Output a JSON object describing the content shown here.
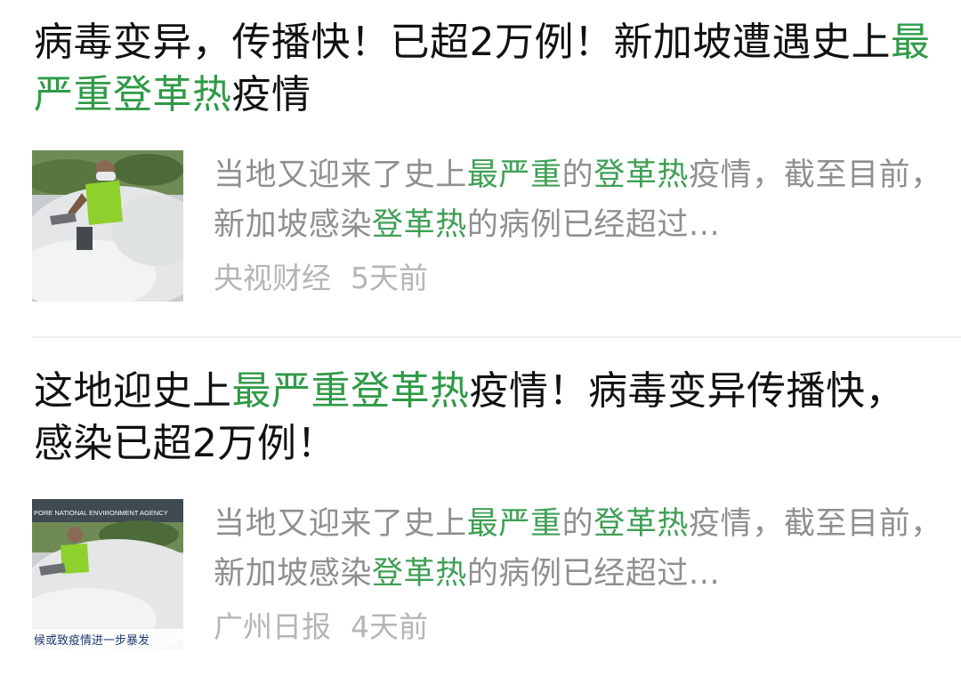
{
  "articles": [
    {
      "title": {
        "p1": "病毒变异，传播快！已超2万例！新加坡遭遇史上",
        "p2": "最严重登革热",
        "p3": "疫情"
      },
      "summary": {
        "s1": "当地又迎来了史上",
        "s2": "最严重",
        "s3": "的",
        "s4": "登革热",
        "s5": "疫情，截至目前，新加坡感染",
        "s6": "登革热",
        "s7": "的病例已经超过..."
      },
      "source": "央视财经",
      "time": "5天前",
      "thumbnail_icon": "fogging-worker-photo"
    },
    {
      "title": {
        "p1": "这地迎史上",
        "p2": "最严重登革热",
        "p3": "疫情！病毒变异传播快，感染已超2万例！"
      },
      "summary": {
        "s1": "当地又迎来了史上",
        "s2": "最严重",
        "s3": "的",
        "s4": "登革热",
        "s5": "疫情，截至目前，新加坡感染",
        "s6": "登革热",
        "s7": "的病例已经超过..."
      },
      "source": "广州日报",
      "time": "4天前",
      "thumbnail_icon": "fogging-worker-news-photo",
      "thumbnail_caption_top": "PORE NATIONAL ENVIRONMENT AGENCY",
      "thumbnail_caption_bottom": "候或致疫情进一步暴发"
    }
  ],
  "colors": {
    "highlight": "#2f9a47",
    "summary_text": "#8f8f8f",
    "meta_text": "#b5b5b5",
    "divider": "#ececec"
  }
}
